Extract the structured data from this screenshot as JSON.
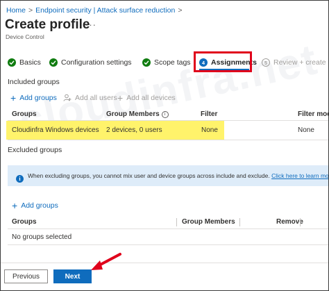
{
  "breadcrumb": {
    "home": "Home",
    "endpoint": "Endpoint security | Attack surface reduction"
  },
  "header": {
    "title": "Create profile",
    "more": "···",
    "subtitle": "Device Control"
  },
  "steps": [
    {
      "label": "Basics",
      "state": "complete"
    },
    {
      "label": "Configuration settings",
      "state": "complete"
    },
    {
      "label": "Scope tags",
      "state": "complete"
    },
    {
      "label": "Assignments",
      "state": "active",
      "number": "4"
    },
    {
      "label": "Review + create",
      "state": "disabled",
      "number": "5"
    }
  ],
  "included": {
    "title": "Included groups",
    "actions": {
      "add_groups": "Add groups",
      "add_all_users": "Add all users",
      "add_all_devices": "Add all devices"
    },
    "columns": {
      "groups": "Groups",
      "group_members": "Group Members",
      "filter": "Filter",
      "filter_mode": "Filter mode"
    },
    "rows": [
      {
        "group": "Cloudinfra Windows devices",
        "members": "2 devices, 0 users",
        "filter": "None",
        "filter_mode": "None"
      }
    ]
  },
  "excluded": {
    "title": "Excluded groups",
    "banner_text": "When excluding groups, you cannot mix user and device groups across include and exclude.",
    "banner_link": "Click here to learn more ab",
    "add_groups": "Add groups",
    "columns": {
      "groups": "Groups",
      "group_members": "Group Members",
      "remove": "Remove"
    },
    "empty": "No groups selected"
  },
  "footer": {
    "previous": "Previous",
    "next": "Next"
  },
  "watermark": "cloudinfra.net",
  "colors": {
    "accent": "#0f6cbd",
    "success": "#107c10",
    "highlight": "#fff36b",
    "annotation": "#e0001b"
  }
}
